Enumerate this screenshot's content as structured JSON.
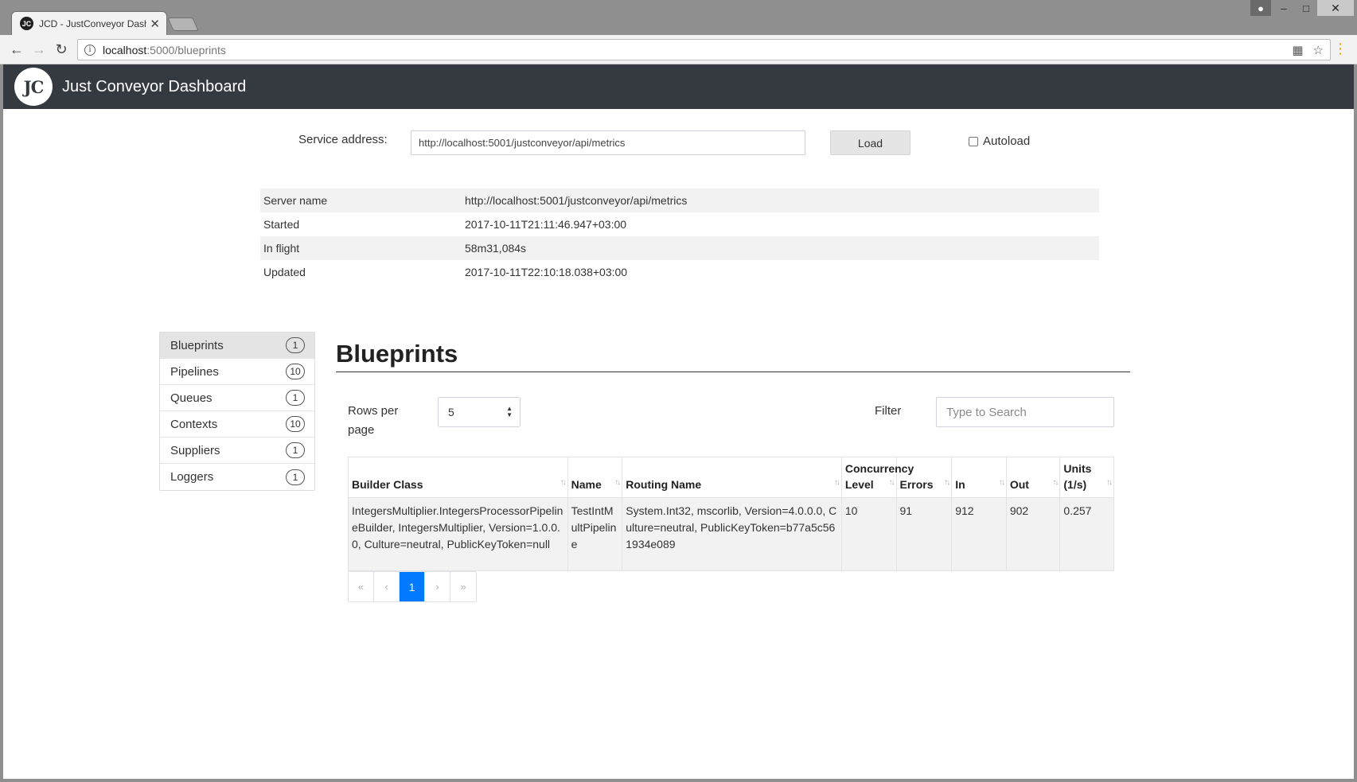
{
  "browser": {
    "tab_title": "JCD - JustConveyor Dash",
    "favicon_text": "JC",
    "url_host": "localhost",
    "url_rest": ":5000/blueprints"
  },
  "app": {
    "brand": "Just Conveyor Dashboard",
    "logo_text": "JC"
  },
  "service": {
    "label": "Service address:",
    "value": "http://localhost:5001/justconveyor/api/metrics",
    "load_label": "Load",
    "autoload_label": "Autoload"
  },
  "server_info": [
    {
      "label": "Server name",
      "value": "http://localhost:5001/justconveyor/api/metrics"
    },
    {
      "label": "Started",
      "value": "2017-10-11T21:11:46.947+03:00"
    },
    {
      "label": "In flight",
      "value": "58m31,084s"
    },
    {
      "label": "Updated",
      "value": "2017-10-11T22:10:18.038+03:00"
    }
  ],
  "sidebar": {
    "items": [
      {
        "label": "Blueprints",
        "count": "1"
      },
      {
        "label": "Pipelines",
        "count": "10"
      },
      {
        "label": "Queues",
        "count": "1"
      },
      {
        "label": "Contexts",
        "count": "10"
      },
      {
        "label": "Suppliers",
        "count": "1"
      },
      {
        "label": "Loggers",
        "count": "1"
      }
    ]
  },
  "main": {
    "title": "Blueprints",
    "rows_per_page_label": "Rows per page",
    "rows_per_page_value": "5",
    "filter_label": "Filter",
    "filter_placeholder": "Type to Search"
  },
  "table": {
    "columns": [
      "Builder Class",
      "Name",
      "Routing Name",
      "Concurrency Level",
      "Errors",
      "In",
      "Out",
      "Units (1/s)"
    ],
    "rows": [
      [
        "IntegersMultiplier.IntegersProcessorPipelineBuilder, IntegersMultiplier, Version=1.0.0.0, Culture=neutral, PublicKeyToken=null",
        "TestIntMultPipeline",
        "System.Int32, mscorlib, Version=4.0.0.0, Culture=neutral, PublicKeyToken=b77a5c561934e089",
        "10",
        "91",
        "912",
        "902",
        "0.257"
      ]
    ]
  },
  "pagination": {
    "first": "«",
    "prev": "‹",
    "current": "1",
    "next": "›",
    "last": "»"
  }
}
